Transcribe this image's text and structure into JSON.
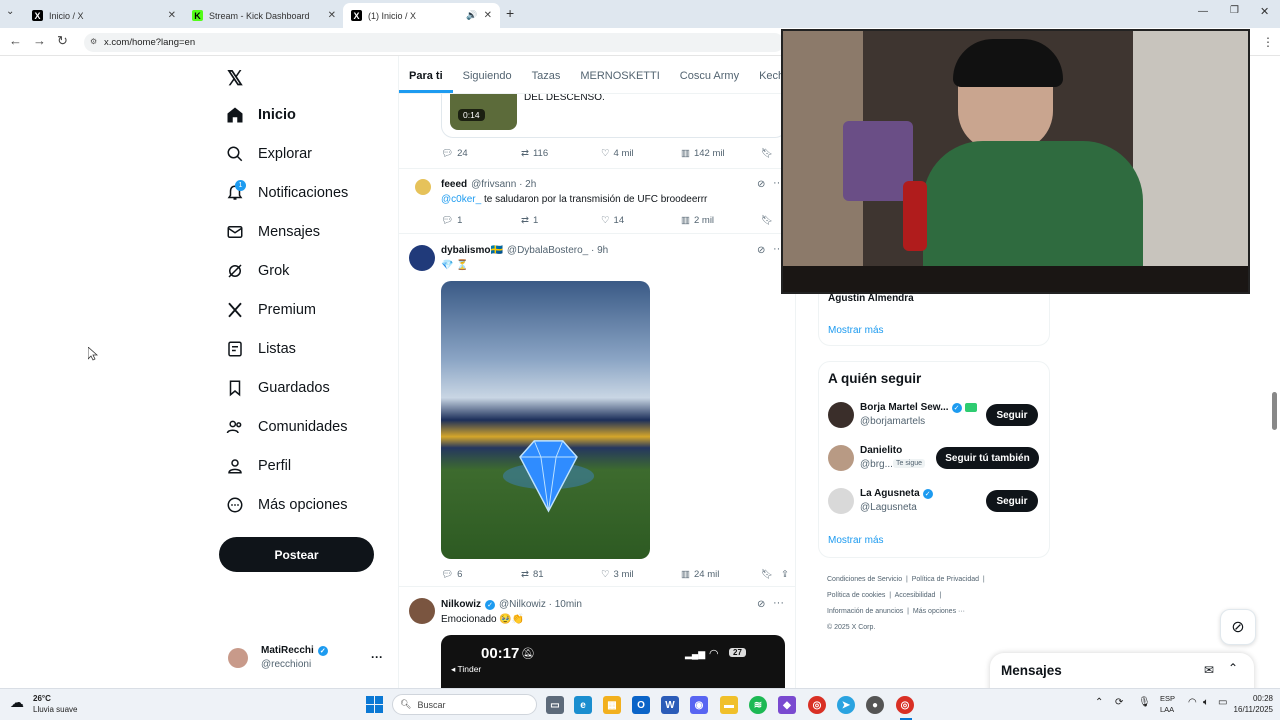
{
  "browser": {
    "tabs": [
      {
        "title": "Inicio / X",
        "active": false
      },
      {
        "title": "Stream - Kick Dashboard",
        "active": false
      },
      {
        "title": "(1) Inicio / X",
        "active": true
      }
    ],
    "url": "x.com/home?lang=en"
  },
  "sidebar": {
    "items": [
      {
        "label": "Inicio",
        "icon": "home-icon"
      },
      {
        "label": "Explorar",
        "icon": "search-icon"
      },
      {
        "label": "Notificaciones",
        "icon": "bell-icon",
        "badge": "1"
      },
      {
        "label": "Mensajes",
        "icon": "mail-icon"
      },
      {
        "label": "Grok",
        "icon": "grok-icon"
      },
      {
        "label": "Premium",
        "icon": "x-icon"
      },
      {
        "label": "Listas",
        "icon": "list-icon"
      },
      {
        "label": "Guardados",
        "icon": "bookmark-icon"
      },
      {
        "label": "Comunidades",
        "icon": "people-icon"
      },
      {
        "label": "Perfil",
        "icon": "person-icon"
      },
      {
        "label": "Más opciones",
        "icon": "more-icon"
      }
    ],
    "post_label": "Postear",
    "account": {
      "name": "MatiRecchi",
      "handle": "@recchioni"
    }
  },
  "feed": {
    "tabs": [
      "Para ti",
      "Siguiendo",
      "Tazas",
      "MERNOSKETTI",
      "Coscu Army",
      "Kecha y"
    ],
    "top_fragment": {
      "text": "DEL DESCENSO.",
      "video_time": "0:14",
      "stats": [
        "24",
        "116",
        "4 mil",
        "142 mil"
      ]
    },
    "tweets": [
      {
        "name": "feeed",
        "handle": "@frivsann · 2h",
        "mention": "@c0ker_",
        "text": " te saludaron por la transmisión de UFC broodeerrr",
        "stats": [
          "1",
          "1",
          "14",
          "2 mil"
        ]
      },
      {
        "name": "dybalismo🇸🇪",
        "handle": "@DybalaBostero_ · 9h",
        "text": "💎 ⏳",
        "stats": [
          "6",
          "81",
          "3 mil",
          "24 mil"
        ]
      },
      {
        "name": "Nilkowiz",
        "handle": "@Nilkowiz · 10min",
        "text": "Emocionado 🥹👏",
        "phone_time": "00:17",
        "phone_app": "◂ Tinder",
        "battery": "27"
      }
    ]
  },
  "right": {
    "trend_tail": "Agustín Almendra",
    "show_more": "Mostrar más",
    "who_to_follow": "A quién seguir",
    "suggestions": [
      {
        "name": "Borja Martel Sew...",
        "handle": "@borjamartels",
        "button": "Seguir"
      },
      {
        "name": "Danielito",
        "handle": "@brg...",
        "follows_you": "Te sigue",
        "button": "Seguir tú también"
      },
      {
        "name": "La Agusneta",
        "handle": "@Lagusneta",
        "button": "Seguir"
      }
    ],
    "show_more_2": "Mostrar más",
    "footer": [
      "Condiciones de Servicio",
      "Política de Privacidad",
      "Política de cookies",
      "Accesibilidad",
      "Información de anuncios",
      "Más opciones ···",
      "© 2025 X Corp."
    ],
    "messages": "Mensajes"
  },
  "taskbar": {
    "weather_temp": "26°C",
    "weather_desc": "Lluvia suave",
    "search": "Buscar",
    "lang": "ESP",
    "lang2": "LAA",
    "time": "00:28",
    "date": "16/11/2025"
  },
  "colors": {
    "accent": "#1d9bf0",
    "dark": "#0f1419",
    "muted": "#536471"
  }
}
